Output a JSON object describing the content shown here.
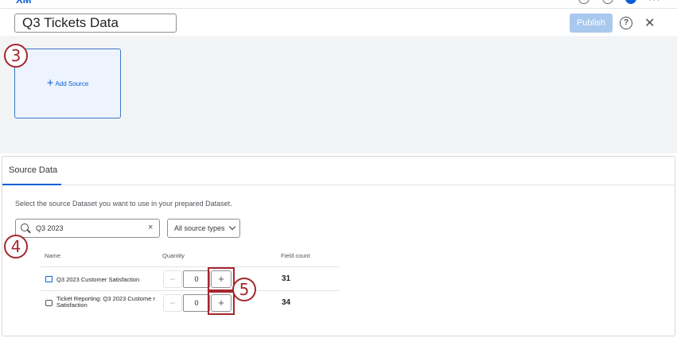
{
  "header": {
    "title": "Q3 Tickets Data",
    "publish_label": "Publish",
    "help_glyph": "?",
    "close_glyph": "✕"
  },
  "canvas": {
    "add_source_label": "Add Source",
    "plus_glyph": "+"
  },
  "callouts": [
    "3",
    "4",
    "5"
  ],
  "panel": {
    "tab_label": "Source Data",
    "instruction": "Select the source Dataset you want to use in your prepared Dataset.",
    "search": {
      "value": "Q3 2023",
      "clear_glyph": "×"
    },
    "filter_label": "All source types",
    "columns": {
      "name": "Name",
      "quantity": "Quantity",
      "field_count": "Field count"
    },
    "rows": [
      {
        "icon": "survey-icon",
        "name": "Q3 2023 Customer Satisfaction",
        "quantity": "0",
        "field_count": "31"
      },
      {
        "icon": "ticket-icon",
        "name": "Ticket Reporting: Q3 2023 Custome r Satisfaction",
        "quantity": "0",
        "field_count": "34"
      }
    ],
    "stepper": {
      "minus": "−",
      "plus": "+"
    }
  },
  "colors": {
    "accent": "#0b5fd6",
    "publish_disabled": "#a9c8ee",
    "annotation": "#a3282e"
  }
}
